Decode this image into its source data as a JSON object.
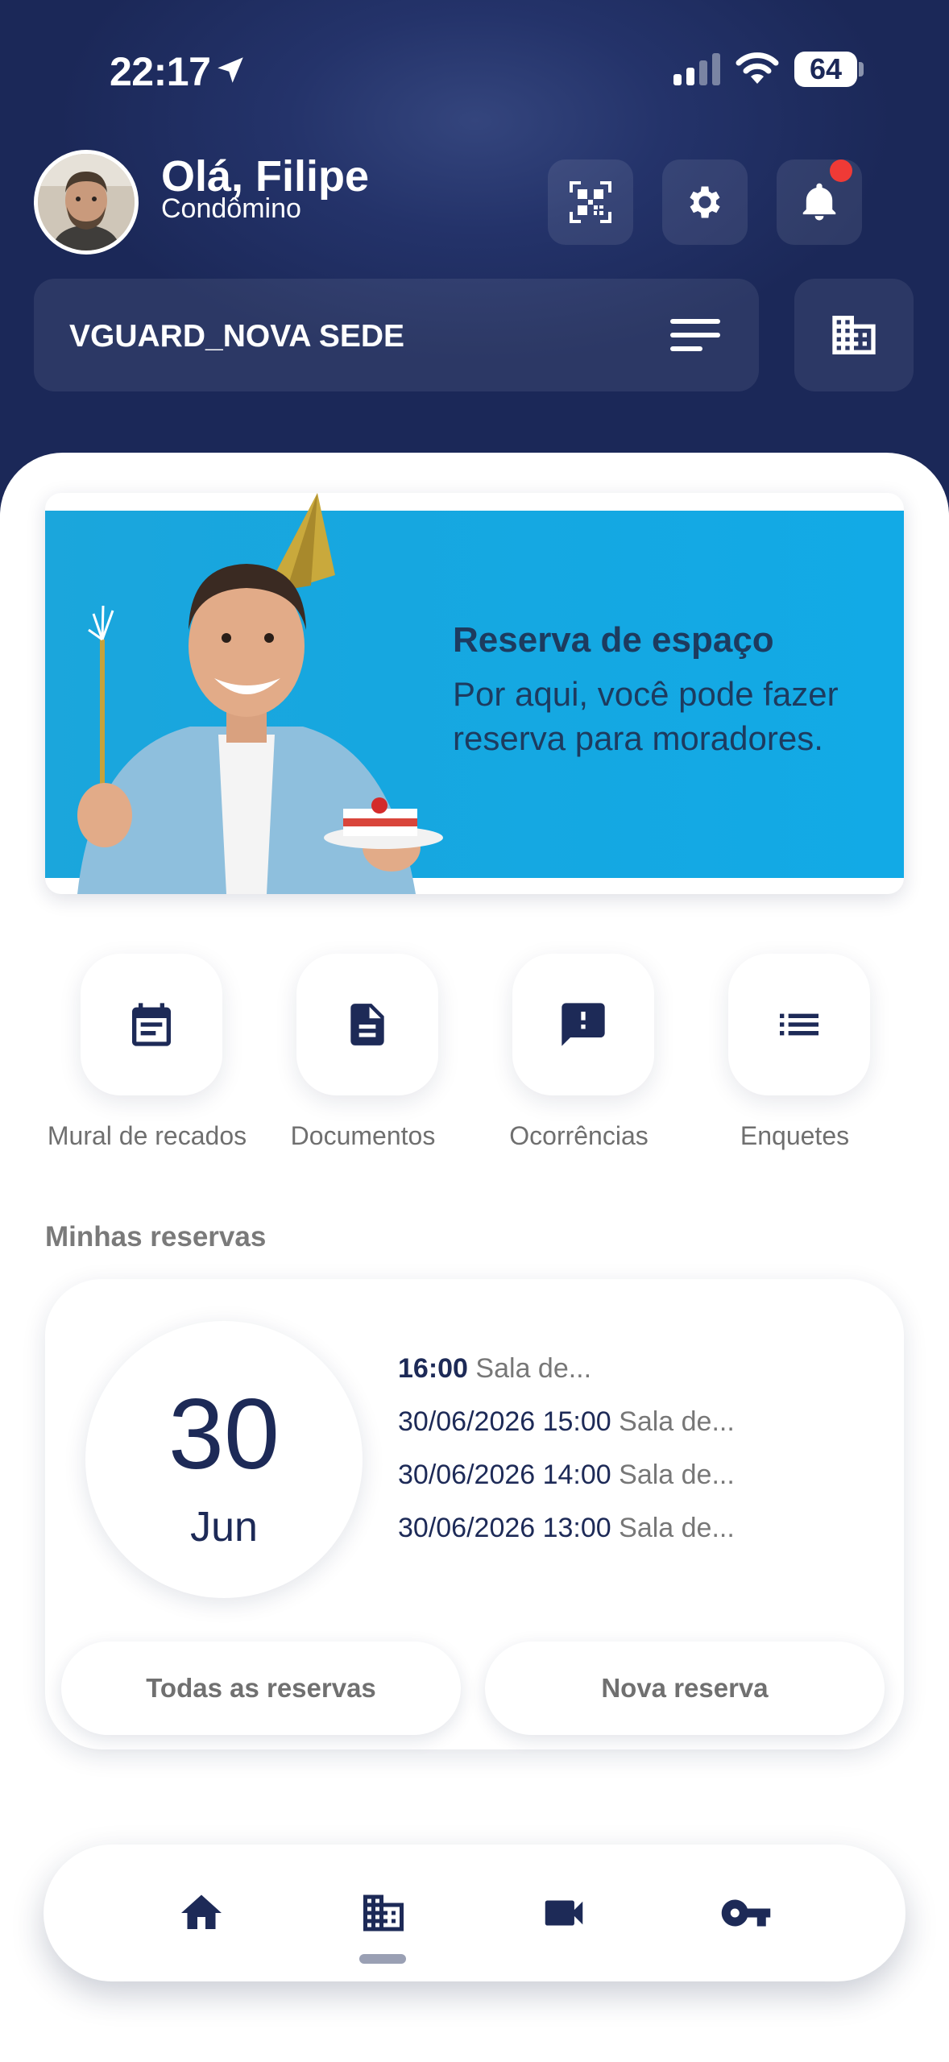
{
  "status_bar": {
    "time": "22:17",
    "battery": "64"
  },
  "header": {
    "greeting": "Olá, Filipe",
    "role": "Condômino"
  },
  "condo": {
    "name": "VGUARD_NOVA SEDE"
  },
  "banner": {
    "title": "Reserva de espaço",
    "text": "Por aqui, você pode fazer reserva para moradores."
  },
  "quick_actions": [
    {
      "label": "Mural de recados",
      "icon": "calendar-board-icon"
    },
    {
      "label": "Documentos",
      "icon": "document-icon"
    },
    {
      "label": "Ocorrências",
      "icon": "alert-message-icon"
    },
    {
      "label": "Enquetes",
      "icon": "list-icon"
    }
  ],
  "reservations": {
    "section_title": "Minhas reservas",
    "day": "30",
    "month": "Jun",
    "items": [
      {
        "datetime": "16:00",
        "room": "Sala de..."
      },
      {
        "datetime": "30/06/2026 15:00",
        "room": "Sala de..."
      },
      {
        "datetime": "30/06/2026 14:00",
        "room": "Sala de..."
      },
      {
        "datetime": "30/06/2026 13:00",
        "room": "Sala de..."
      }
    ],
    "all_label": "Todas as reservas",
    "new_label": "Nova reserva"
  },
  "bottom_nav": {
    "items": [
      "home-icon",
      "building-icon",
      "video-camera-icon",
      "key-icon"
    ],
    "active": "building-icon"
  },
  "colors": {
    "primary": "#1d2a57",
    "header_bg": "#1b2858",
    "notification": "#ef3a36",
    "banner_bg": "#16a7e0"
  }
}
